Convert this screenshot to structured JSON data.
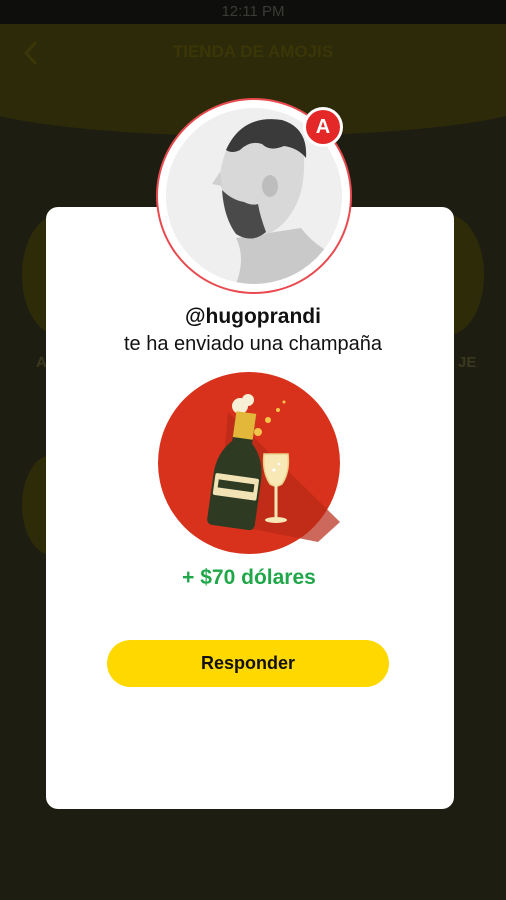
{
  "status_bar": {
    "time": "12:11 PM"
  },
  "header": {
    "title": "TIENDA DE AMOJIS"
  },
  "background": {
    "label_left": "A",
    "label_right": "JE"
  },
  "modal": {
    "avatar_badge": "A",
    "username": "@hugoprandi",
    "message": "te ha enviado una champaña",
    "gift_icon": "champagne-icon",
    "amount": "+ $70 dólares",
    "reply_label": "Responder"
  },
  "colors": {
    "accent": "#ffd800",
    "badge": "#e42828",
    "amount": "#20a74a",
    "gift_background": "#d8321c"
  }
}
